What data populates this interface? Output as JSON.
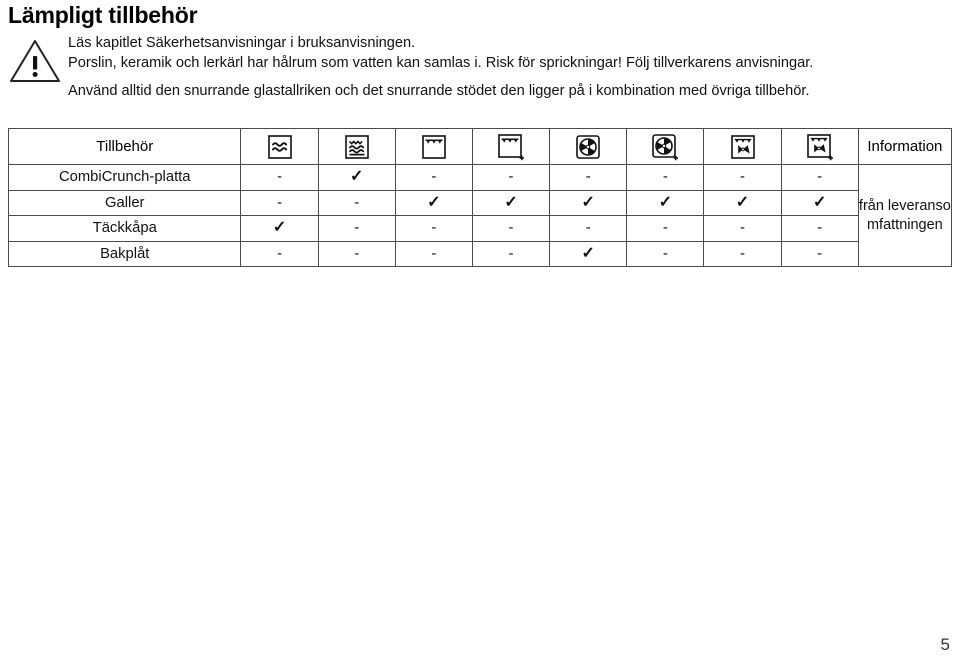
{
  "document": {
    "title": "Lämpligt tillbehör",
    "page_number": "5"
  },
  "warning": {
    "icon": "warning-triangle-icon",
    "line1": "Läs kapitlet Säkerhetsanvisningar i bruksanvisningen.",
    "line2": "Porslin, keramik och lerkärl har hålrum som vatten kan samlas i. Risk för sprickningar! Följ tillverkarens anvisningar.",
    "line3": "Använd alltid den snurrande glastallriken och det snurrande stödet den ligger på i kombination med övriga tillbehör."
  },
  "table": {
    "headers": {
      "accessory": "Tillbehör",
      "information": "Information"
    },
    "icon_columns": [
      {
        "key": "microwave",
        "icon": "microwave-icon",
        "label": "Mikrovågor"
      },
      {
        "key": "microwave-bottom-heat",
        "icon": "microwave-with-bottom-heat-icon",
        "label": "Mikrovågor med undervärme"
      },
      {
        "key": "grill",
        "icon": "grill-icon",
        "label": "Grill"
      },
      {
        "key": "grill-microwave",
        "icon": "grill-plus-microwave-icon",
        "label": "Grill + mikrovågor"
      },
      {
        "key": "hot-air",
        "icon": "hot-air-fan-icon",
        "label": "Varmluft"
      },
      {
        "key": "hot-air-microwave",
        "icon": "hot-air-fan-plus-microwave-icon",
        "label": "Varmluft + mikrovågor"
      },
      {
        "key": "grill-hot-air",
        "icon": "grill-hot-air-icon",
        "label": "Grill + varmluft"
      },
      {
        "key": "grill-hot-air-microwave",
        "icon": "grill-hot-air-plus-microwave-icon",
        "label": "Grill + varmluft + mikrovågor"
      }
    ],
    "rows": [
      {
        "accessory": "CombiCrunch-platta",
        "values": [
          "-",
          "✓",
          "-",
          "-",
          "-",
          "-",
          "-",
          "-"
        ],
        "information": ""
      },
      {
        "accessory": "Galler",
        "values": [
          "-",
          "-",
          "✓",
          "✓",
          "✓",
          "✓",
          "✓",
          "✓"
        ],
        "information": "från leveransomfattningen"
      },
      {
        "accessory": "Täckkåpa",
        "values": [
          "✓",
          "-",
          "-",
          "-",
          "-",
          "-",
          "-",
          "-"
        ],
        "information": ""
      },
      {
        "accessory": "Bakplåt",
        "values": [
          "-",
          "-",
          "-",
          "-",
          "✓",
          "-",
          "-",
          "-"
        ],
        "information": ""
      }
    ]
  },
  "colors": {
    "text": "#111111",
    "border": "#4a4a4a",
    "background": "#ffffff"
  }
}
